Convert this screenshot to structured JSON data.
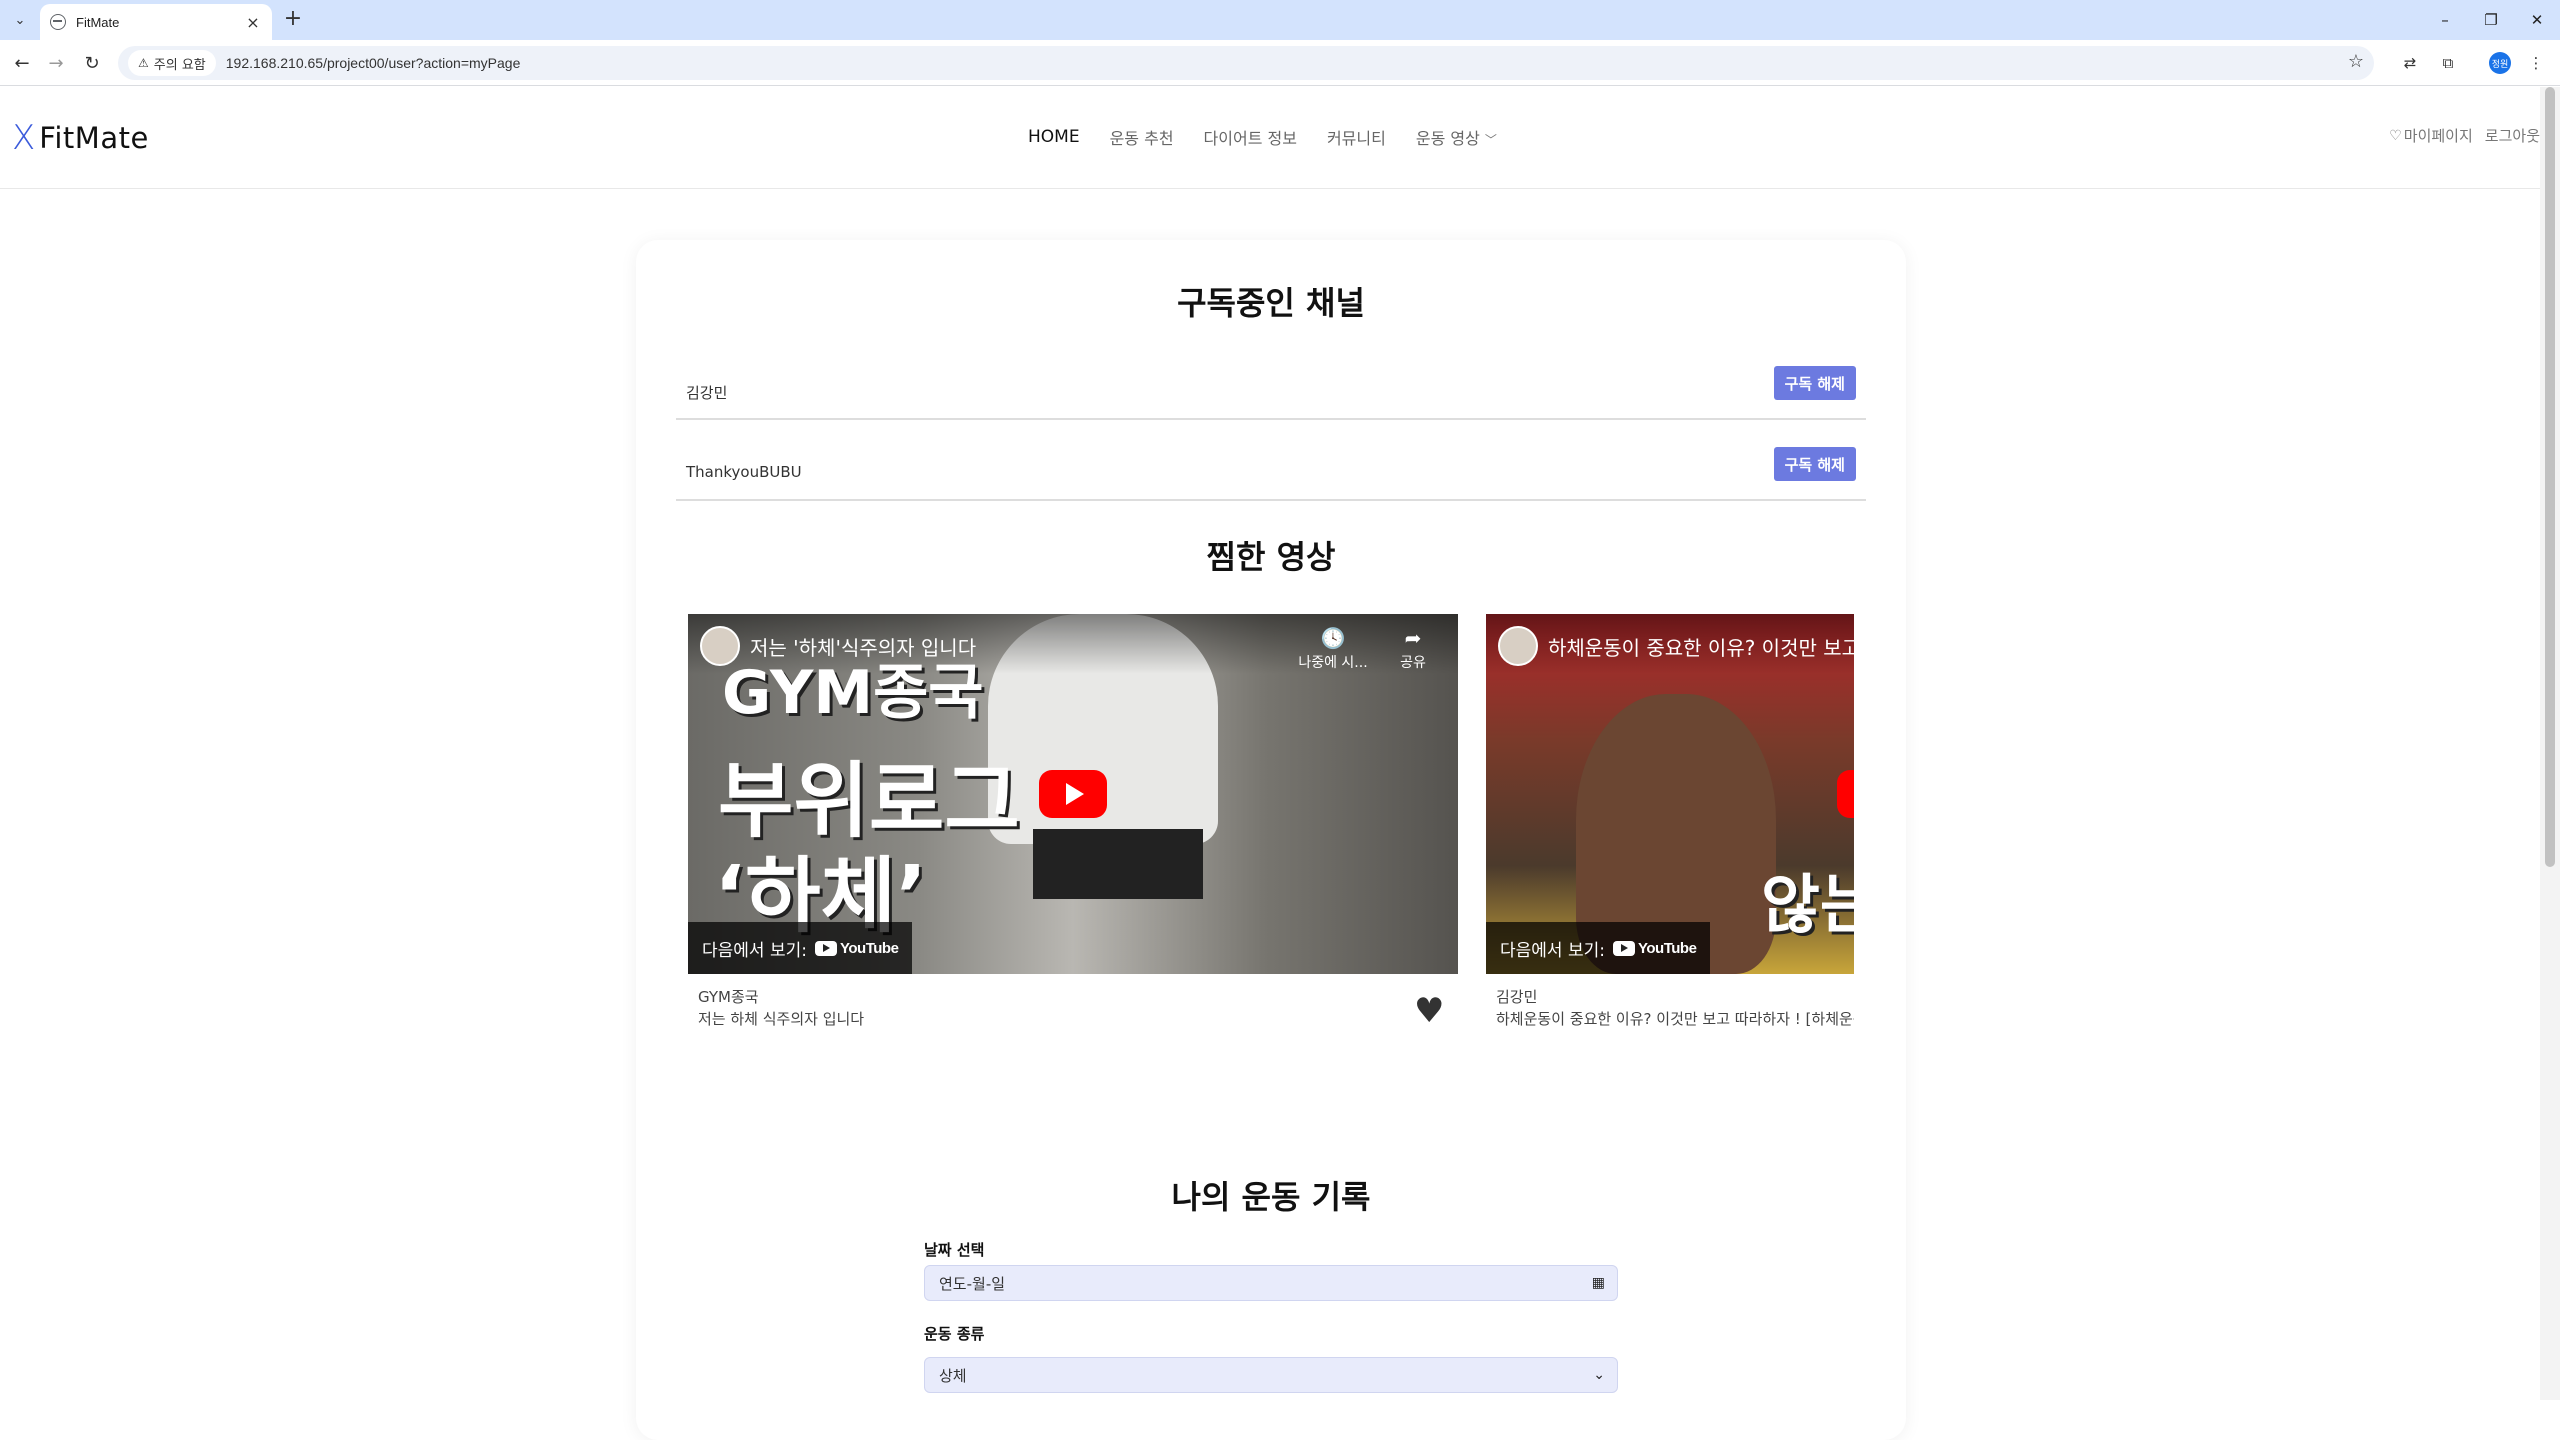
{
  "browser": {
    "tab_title": "FitMate",
    "security_label": "주의 요함",
    "url": "192.168.210.65/project00/user?action=myPage",
    "profile_initials": "정원"
  },
  "header": {
    "logo_mark": "X",
    "logo_text": "FitMate",
    "nav": [
      {
        "label": "HOME"
      },
      {
        "label": "운동 추천"
      },
      {
        "label": "다이어트 정보"
      },
      {
        "label": "커뮤니티"
      },
      {
        "label": "운동 영상"
      }
    ],
    "mypage_label": "마이페이지",
    "logout_label": "로그아웃"
  },
  "subscriptions": {
    "title": "구독중인 채널",
    "channels": [
      {
        "name": "김강민",
        "button": "구독 해제"
      },
      {
        "name": "ThankyouBUBU",
        "button": "구독 해제"
      }
    ]
  },
  "favorites": {
    "title": "찜한 영상",
    "videos": [
      {
        "overlay_title": "저는 '하체'식주의자 입니다",
        "watch_later": "나중에 시...",
        "share": "공유",
        "big_line1": "GYM종국",
        "big_line2": "부위로그",
        "big_line3": "‘하체’",
        "watch_on": "다음에서 보기:",
        "yt_brand": "YouTube",
        "channel": "GYM종국",
        "description": "저는 하체 식주의자 입니다"
      },
      {
        "overlay_title": "하체운동이 중요한 이유? 이것만 보고 따",
        "big_text": "않는",
        "watch_on": "다음에서 보기:",
        "yt_brand": "YouTube",
        "channel": "김강민",
        "description": "하체운동이 중요한 이유? 이것만 보고 따라하자 ! [하체운동"
      }
    ]
  },
  "records": {
    "title": "나의 운동 기록",
    "date_label": "날짜 선택",
    "date_placeholder": "연도-월-일",
    "type_label": "운동 종류",
    "type_value": "상체"
  }
}
